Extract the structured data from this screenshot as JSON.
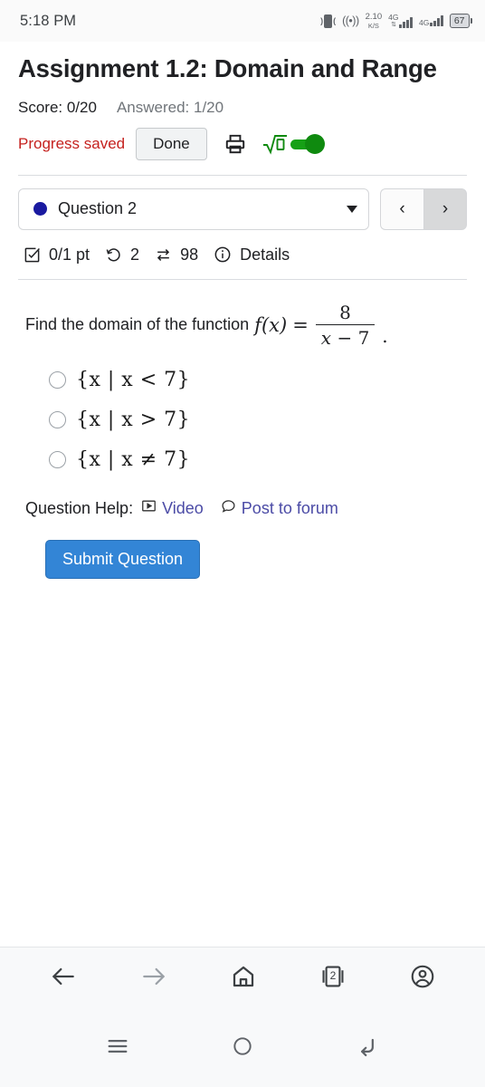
{
  "statusbar": {
    "time": "5:18 PM",
    "vibrate_icon": "vibrate-icon",
    "hotspot_icon": "((•))",
    "net_speed_value": "2.10",
    "net_speed_unit": "K/S",
    "sim1_network": "4G",
    "sim1_arrows": "⇅",
    "sim2_network": "4G",
    "battery_percent": "67"
  },
  "assignment": {
    "title": "Assignment 1.2: Domain and Range",
    "score_label": "Score: 0/20",
    "answered_label": "Answered: 1/20",
    "progress_saved": "Progress saved",
    "done_label": "Done",
    "print_icon": "printer-icon",
    "math_toggle_label": "√0",
    "math_toggle_state": "on"
  },
  "selector": {
    "question_label": "Question 2",
    "status_dot_color": "#1a1aa0",
    "prev_label": "‹",
    "next_label": "›"
  },
  "stats": {
    "points": "0/1 pt",
    "attempts": "2",
    "versions": "98",
    "details_label": "Details"
  },
  "question": {
    "prompt": "Find the domain of the function",
    "function_name": "f(x)",
    "equals": "=",
    "numerator": "8",
    "denominator_var": "x",
    "denominator_op": "−",
    "denominator_num": "7",
    "period": ".",
    "options": [
      {
        "text": "{x | x < 7}",
        "selected": false
      },
      {
        "text": "{x | x > 7}",
        "selected": false
      },
      {
        "text": "{x | x ≠ 7}",
        "selected": false
      }
    ]
  },
  "help": {
    "label": "Question Help:",
    "video_label": "Video",
    "forum_label": "Post to forum",
    "link_color": "#4b4ba6"
  },
  "submit": {
    "label": "Submit Question",
    "color": "#3385d6"
  },
  "browserbar": {
    "back_icon": "back-arrow-icon",
    "forward_icon": "forward-arrow-icon",
    "home_icon": "home-icon",
    "tabs_count": "2",
    "profile_icon": "profile-icon"
  },
  "androidnav": {
    "recents_icon": "recents-icon",
    "home_icon": "home-circle-icon",
    "back_icon": "back-curved-icon"
  }
}
